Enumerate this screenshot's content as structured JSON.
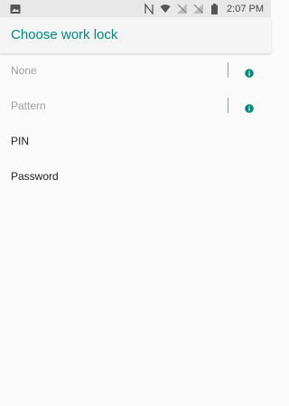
{
  "status_bar": {
    "time": "2:07 PM",
    "icons": [
      "image-icon",
      "nfc-icon",
      "wifi-icon",
      "signal-icon",
      "signal-icon",
      "battery-icon"
    ]
  },
  "app_bar": {
    "title": "Choose work lock"
  },
  "options": [
    {
      "label": "None",
      "disabled": true,
      "has_info": true
    },
    {
      "label": "Pattern",
      "disabled": true,
      "has_info": true
    },
    {
      "label": "PIN",
      "disabled": false,
      "has_info": false
    },
    {
      "label": "Password",
      "disabled": false,
      "has_info": false
    }
  ],
  "colors": {
    "accent": "#00897b",
    "disabled_text": "#9e9e9e",
    "background": "#fafafa"
  }
}
